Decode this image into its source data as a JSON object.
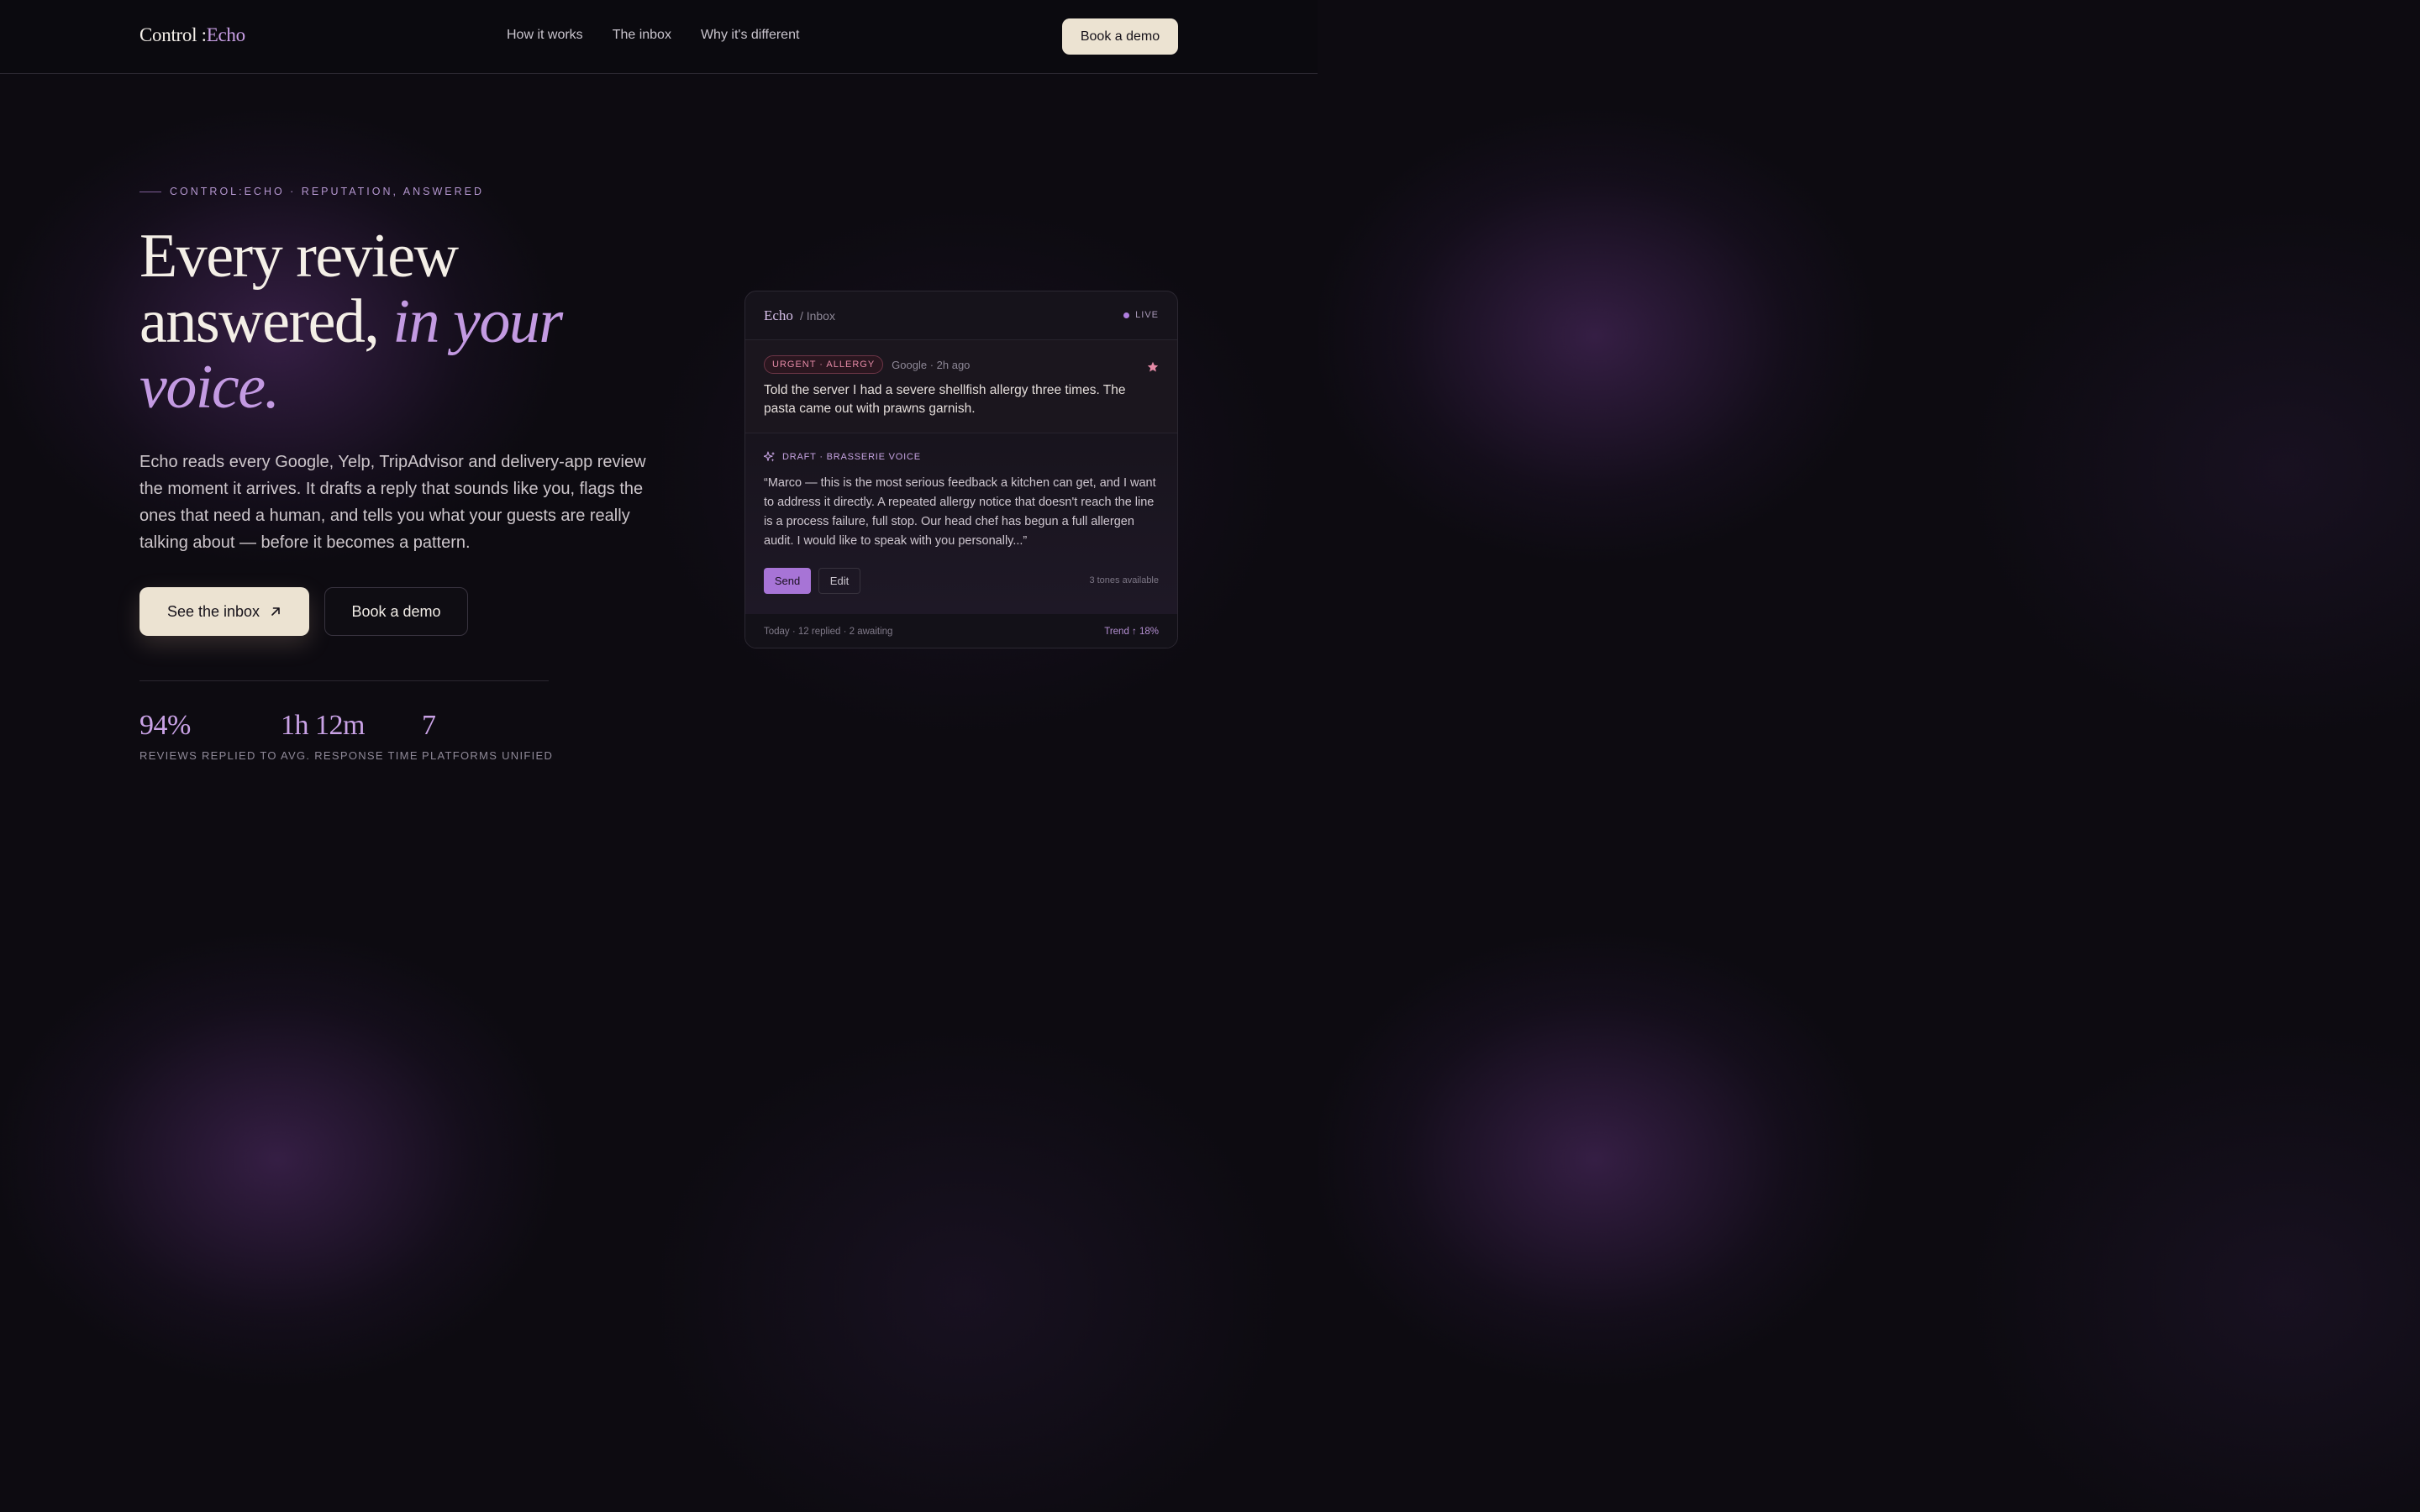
{
  "nav": {
    "logo_main": "Control :",
    "logo_accent": "Echo",
    "links": [
      "How it works",
      "The inbox",
      "Why it's different"
    ],
    "cta": "Book a demo"
  },
  "hero": {
    "eyebrow": "CONTROL:ECHO · REPUTATION, ANSWERED",
    "headline_line1": "Every review",
    "headline_line2": "answered,",
    "headline_em1": "in your",
    "headline_em2": "voice.",
    "lead": "Echo reads every Google, Yelp, TripAdvisor and delivery-app review the moment it arrives. It drafts a reply that sounds like you, flags the ones that need a human, and tells you what your guests are really talking about — before it becomes a pattern.",
    "primary_cta": "See the inbox",
    "secondary_cta": "Book a demo"
  },
  "stats": [
    {
      "value": "94%",
      "label": "REVIEWS REPLIED TO"
    },
    {
      "value": "1h 12m",
      "label": "AVG. RESPONSE TIME"
    },
    {
      "value": "7",
      "label": "PLATFORMS UNIFIED"
    }
  ],
  "inbox": {
    "brand": "Echo",
    "crumb": "/ Inbox",
    "status": "LIVE",
    "review": {
      "tag": "URGENT · ALLERGY",
      "source": "Google · 2h ago",
      "text": "Told the server I had a severe shellfish allergy three times. The pasta came out with prawns garnish."
    },
    "draft": {
      "label": "DRAFT · BRASSERIE VOICE",
      "text": "“Marco — this is the most serious feedback a kitchen can get, and I want to address it directly. A repeated allergy notice that doesn't reach the line is a process failure, full stop. Our head chef has begun a full allergen audit. I would like to speak with you personally...”",
      "send": "Send",
      "edit": "Edit",
      "tones": "3 tones available"
    },
    "footer": {
      "summary": "Today · 12 replied · 2 awaiting",
      "trend": "Trend ↑ 18%"
    }
  },
  "colors": {
    "accent": "#c39ae2",
    "cream": "#ece3d2",
    "urgent": "#e58aa6",
    "background": "#0d0b11"
  }
}
